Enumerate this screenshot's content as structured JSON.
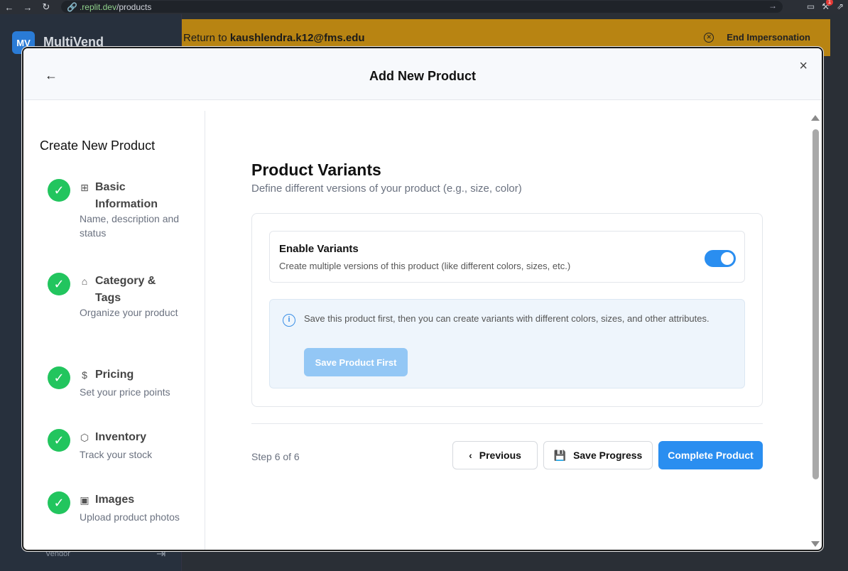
{
  "browser": {
    "url_prefix": ".replit.dev",
    "url_path": "/products",
    "notification_count": "1"
  },
  "app": {
    "logo": "MV",
    "name": "MultiVend",
    "user_role": "Vendor"
  },
  "impersonation": {
    "return_prefix": "Return to",
    "email": "kaushlendra.k12@fms.edu",
    "end_label": "End Impersonation"
  },
  "modal": {
    "title": "Add New Product",
    "sidebar_title": "Create New Product",
    "steps": [
      {
        "label": "Basic Information",
        "desc": "Name, description and status",
        "icon": "grid-icon",
        "completed": true
      },
      {
        "label": "Category & Tags",
        "desc": "Organize your product",
        "icon": "tag-icon",
        "completed": true
      },
      {
        "label": "Pricing",
        "desc": "Set your price points",
        "icon": "dollar-icon",
        "completed": true
      },
      {
        "label": "Inventory",
        "desc": "Track your stock",
        "icon": "box-icon",
        "completed": true
      },
      {
        "label": "Images",
        "desc": "Upload product photos",
        "icon": "image-icon",
        "completed": true
      }
    ],
    "section": {
      "title": "Product Variants",
      "subtitle": "Define different versions of your product (e.g., size, color)"
    },
    "variants": {
      "toggle_title": "Enable Variants",
      "toggle_desc": "Create multiple versions of this product (like different colors, sizes, etc.)",
      "enabled": true,
      "info_text": "Save this product first, then you can create variants with different colors, sizes, and other attributes.",
      "save_first_label": "Save Product First"
    },
    "footer": {
      "step_text": "Step 6 of 6",
      "previous_label": "Previous",
      "save_progress_label": "Save Progress",
      "complete_label": "Complete Product"
    }
  },
  "colors": {
    "accent": "#2a8ef0",
    "success": "#22c55e",
    "impersonation_bar": "#b88412"
  }
}
